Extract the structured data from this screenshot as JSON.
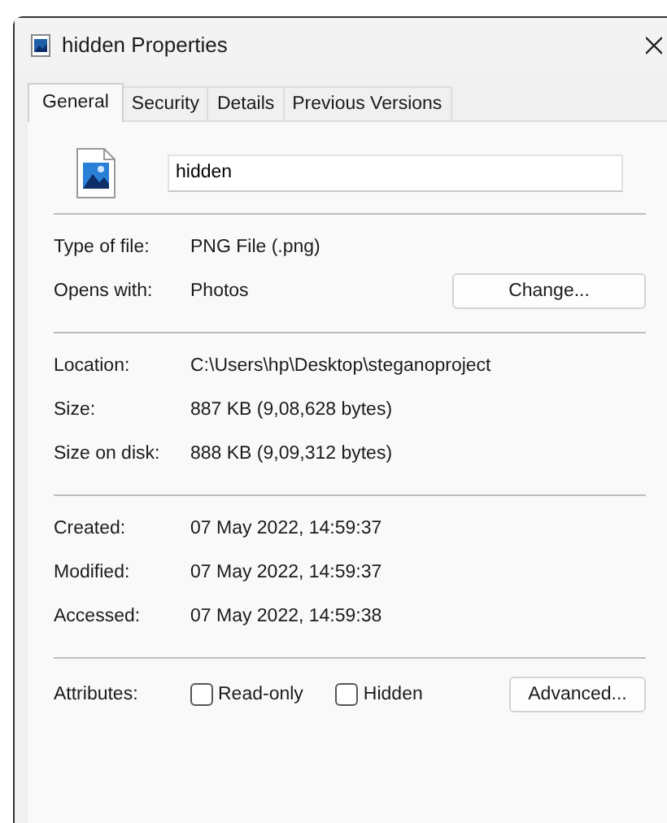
{
  "window": {
    "title": "hidden Properties"
  },
  "tabs": [
    {
      "label": "General",
      "selected": true
    },
    {
      "label": "Security",
      "selected": false
    },
    {
      "label": "Details",
      "selected": false
    },
    {
      "label": "Previous Versions",
      "selected": false
    }
  ],
  "file_name": {
    "value": "hidden"
  },
  "sections": [
    {
      "rows": [
        {
          "label": "Type of file:",
          "value": "PNG File (.png)"
        },
        {
          "label": "Opens with:",
          "value": "Photos",
          "button": "Change..."
        }
      ]
    },
    {
      "rows": [
        {
          "label": "Location:",
          "value": "C:\\Users\\hp\\Desktop\\steganoproject"
        },
        {
          "label": "Size:",
          "value": "887 KB (9,08,628 bytes)"
        },
        {
          "label": "Size on disk:",
          "value": "888 KB (9,09,312 bytes)"
        }
      ]
    },
    {
      "rows": [
        {
          "label": "Created:",
          "value": "07 May 2022, 14:59:37"
        },
        {
          "label": "Modified:",
          "value": "07 May 2022, 14:59:37"
        },
        {
          "label": "Accessed:",
          "value": "07 May 2022, 14:59:38"
        }
      ]
    }
  ],
  "attributes": {
    "label": "Attributes:",
    "options": [
      {
        "label": "Read-only",
        "checked": false
      },
      {
        "label": "Hidden",
        "checked": false
      }
    ],
    "button": "Advanced..."
  }
}
